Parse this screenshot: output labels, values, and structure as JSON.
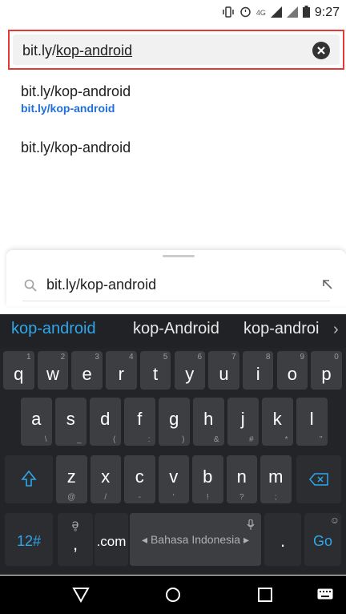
{
  "status_bar": {
    "time": "9:27"
  },
  "url_bar": {
    "text_plain": "bit.ly/",
    "text_underlined": "kop-android"
  },
  "suggestions": [
    {
      "title": "bit.ly/kop-android",
      "subtitle": "bit.ly/kop-android"
    },
    {
      "title": "bit.ly/kop-android",
      "subtitle": ""
    }
  ],
  "sheet": {
    "query": "bit.ly/kop-android"
  },
  "keyboard": {
    "suggestions": [
      "kop-android",
      "kop-Android",
      "kop-androi"
    ],
    "row1": [
      {
        "main": "q",
        "sub": "1"
      },
      {
        "main": "w",
        "sub": "2"
      },
      {
        "main": "e",
        "sub": "3"
      },
      {
        "main": "r",
        "sub": "4"
      },
      {
        "main": "t",
        "sub": "5"
      },
      {
        "main": "y",
        "sub": "6"
      },
      {
        "main": "u",
        "sub": "7"
      },
      {
        "main": "i",
        "sub": "8"
      },
      {
        "main": "o",
        "sub": "9"
      },
      {
        "main": "p",
        "sub": "0"
      }
    ],
    "row2": [
      {
        "main": "a",
        "sub": "\\"
      },
      {
        "main": "s",
        "sub": "_"
      },
      {
        "main": "d",
        "sub": "("
      },
      {
        "main": "f",
        "sub": ":"
      },
      {
        "main": "g",
        "sub": ")"
      },
      {
        "main": "h",
        "sub": "&"
      },
      {
        "main": "j",
        "sub": "#"
      },
      {
        "main": "k",
        "sub": "*"
      },
      {
        "main": "l",
        "sub": "\""
      }
    ],
    "row3": [
      {
        "main": "z",
        "sub": "@"
      },
      {
        "main": "x",
        "sub": "/"
      },
      {
        "main": "c",
        "sub": "-"
      },
      {
        "main": "v",
        "sub": "'"
      },
      {
        "main": "b",
        "sub": "!"
      },
      {
        "main": "n",
        "sub": "?"
      },
      {
        "main": "m",
        "sub": ";"
      }
    ],
    "row4": {
      "num_label": "12#",
      "comma": ",",
      "dot_com": ".com",
      "language": "Bahasa Indonesia",
      "period": ".",
      "go_label": "Go"
    }
  }
}
